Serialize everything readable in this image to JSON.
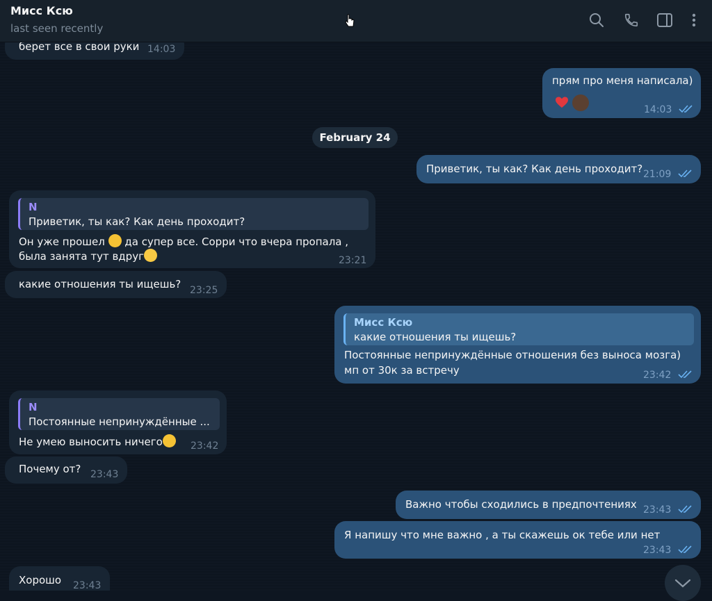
{
  "header": {
    "name": "Мисс Ксю",
    "status": "last seen recently",
    "icons": [
      "search-icon",
      "phone-icon",
      "sidebar-icon",
      "more-icon"
    ]
  },
  "date_separator": "February 24",
  "messages": [
    {
      "id": "m1",
      "direction": "in",
      "text": "берет все в свои руки",
      "time": "14:03"
    },
    {
      "id": "m2",
      "direction": "out",
      "text": "прям про меня написала)",
      "time": "14:03",
      "reactions": [
        "heart",
        "avatar"
      ]
    },
    {
      "id": "m3",
      "direction": "out",
      "text": "Приветик, ты как? Как день проходит?",
      "time": "21:09"
    },
    {
      "id": "m4",
      "direction": "in",
      "reply": {
        "name": "N",
        "text": "Приветик, ты как? Как день проходит?"
      },
      "line1_a": "Он уже прошел",
      "line1_b": "да супер все. Сорри что вчера пропала ,",
      "line2": "была занята тут вдруг",
      "time": "23:21"
    },
    {
      "id": "m5",
      "direction": "in",
      "text": "какие отношения ты ищешь?",
      "time": "23:25"
    },
    {
      "id": "m6",
      "direction": "out",
      "reply": {
        "name": "Мисс Ксю",
        "text": "какие отношения ты ищешь?"
      },
      "line1": "Постоянные непринуждённые отношения без выноса мозга)",
      "line2": "мп от 30к за встречу",
      "time": "23:42"
    },
    {
      "id": "m7",
      "direction": "in",
      "reply": {
        "name": "N",
        "text": "Постоянные непринуждённые ..."
      },
      "text": "Не умею выносить ничего",
      "time": "23:42"
    },
    {
      "id": "m8",
      "direction": "in",
      "text": "Почему от?",
      "time": "23:43"
    },
    {
      "id": "m9",
      "direction": "out",
      "text": "Важно чтобы сходились в предпочтениях",
      "time": "23:43"
    },
    {
      "id": "m10",
      "direction": "out",
      "text": "Я напишу что мне важно , а ты скажешь ок тебе или нет",
      "time": "23:43"
    },
    {
      "id": "m11",
      "direction": "in",
      "text": "Хорошо",
      "time": "23:43"
    }
  ],
  "colors": {
    "incoming": "#182533",
    "outgoing": "#2b5278",
    "background": "#0e1621",
    "accent": "#6ab2f2"
  }
}
